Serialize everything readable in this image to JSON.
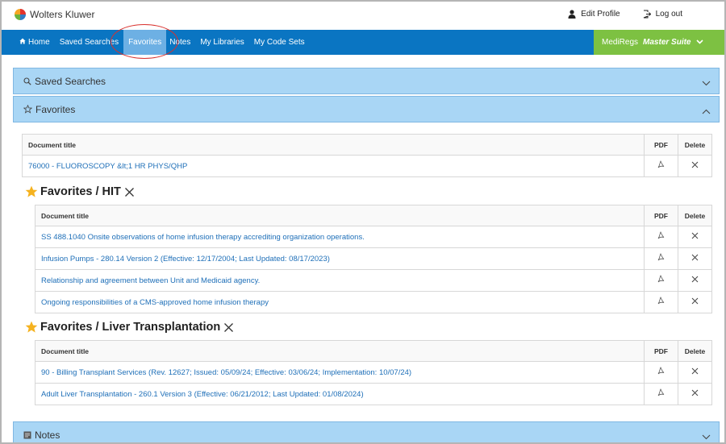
{
  "header": {
    "brand": "Wolters Kluwer",
    "edit_profile": "Edit Profile",
    "logout": "Log out"
  },
  "nav": {
    "items": [
      {
        "label": "Home"
      },
      {
        "label": "Saved Searches"
      },
      {
        "label": "Favorites"
      },
      {
        "label": "Notes"
      },
      {
        "label": "My Libraries"
      },
      {
        "label": "My Code Sets"
      }
    ],
    "suite_prefix": "MediRegs",
    "suite_name": "Master Suite"
  },
  "accordions": {
    "saved_searches": "Saved Searches",
    "favorites": "Favorites",
    "notes": "Notes"
  },
  "table_headers": {
    "title": "Document title",
    "pdf": "PDF",
    "delete": "Delete"
  },
  "favorites_root": {
    "rows": [
      {
        "title": "76000 - FLUOROSCOPY &lt;1 HR PHYS/QHP"
      }
    ]
  },
  "groups": [
    {
      "title": "Favorites / HIT",
      "rows": [
        {
          "title": "SS 488.1040 Onsite observations of home infusion therapy accrediting organization operations."
        },
        {
          "title": "Infusion Pumps - 280.14 Version 2 (Effective: 12/17/2004; Last Updated: 08/17/2023)"
        },
        {
          "title": "Relationship and agreement between Unit and Medicaid agency."
        },
        {
          "title": "Ongoing responsibilities of a CMS-approved home infusion therapy"
        }
      ]
    },
    {
      "title": "Favorites / Liver Transplantation",
      "rows": [
        {
          "title": "90 - Billing Transplant Services (Rev. 12627; Issued: 05/09/24; Effective: 03/06/24; Implementation: 10/07/24)"
        },
        {
          "title": "Adult Liver Transplantation - 260.1 Version 3 (Effective: 06/21/2012; Last Updated: 01/08/2024)"
        }
      ]
    }
  ],
  "colors": {
    "nav_blue": "#0a75c2",
    "nav_active": "#6db0e4",
    "suite_green": "#7dc142",
    "accordion_bg": "#a9d6f5",
    "link_blue": "#1e6fb8",
    "star": "#f5b21f",
    "highlight_circle": "#d9322e"
  }
}
